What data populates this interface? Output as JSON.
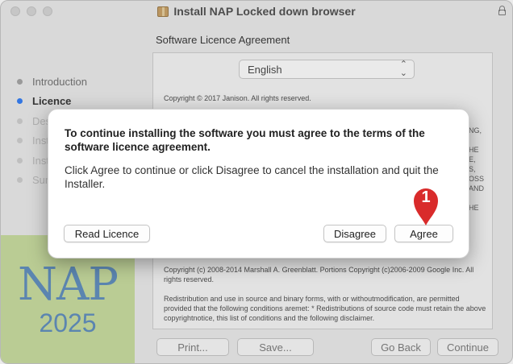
{
  "window": {
    "title": "Install NAP Locked down browser"
  },
  "sidebar": {
    "steps": [
      {
        "label": "Introduction",
        "state": "done"
      },
      {
        "label": "Licence",
        "state": "active"
      },
      {
        "label": "Destination Select",
        "state": "hidden"
      },
      {
        "label": "Installation Type",
        "state": "hidden"
      },
      {
        "label": "Installation",
        "state": "hidden"
      },
      {
        "label": "Summary",
        "state": "hidden"
      }
    ],
    "brand_top": "NAP",
    "brand_bottom": "2025"
  },
  "main": {
    "heading": "Software Licence Agreement",
    "language": "English",
    "licence_copyright": "Copyright © 2017 Janison. All rights reserved.",
    "licence_p2": "Copyright (c) 2008-2014 Marshall A. Greenblatt. Portions Copyright (c)2006-2009 Google Inc. All rights reserved.",
    "licence_p3": "Redistribution and use in source and binary forms, with or withoutmodification, are permitted provided that the following conditions aremet:   * Redistributions of source code must retain the above copyrightnotice, this list of conditions and the following disclaimer.",
    "clipped_fragments": [
      "NG,",
      "HE",
      "E,",
      "S,",
      "OSS",
      "AND",
      "HE"
    ]
  },
  "buttons": {
    "print": "Print...",
    "save": "Save...",
    "go_back": "Go Back",
    "continue": "Continue"
  },
  "modal": {
    "title": "To continue installing the software you must agree to the terms of the software licence agreement.",
    "message": "Click Agree to continue or click Disagree to cancel the installation and quit the Installer.",
    "read_licence": "Read Licence",
    "disagree": "Disagree",
    "agree": "Agree"
  },
  "callout": {
    "number": "1",
    "color": "#d92b2b"
  },
  "colors": {
    "accent": "#2f7cf6",
    "brand_bg": "#c9dd9e",
    "brand_text": "#5d8dbe"
  }
}
